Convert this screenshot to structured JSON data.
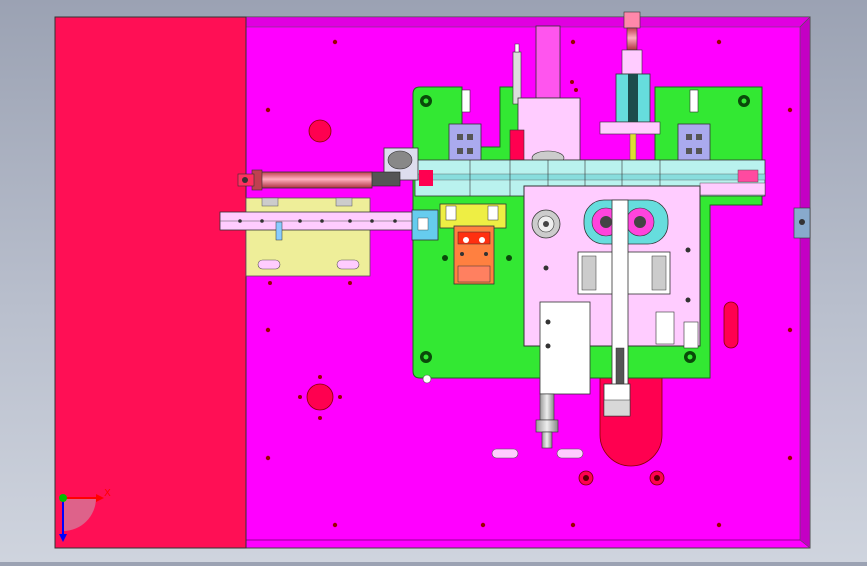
{
  "viewport": {
    "background_top": "#9ba2b3",
    "background_bottom": "#cfd4de"
  },
  "colors": {
    "plate": "#ff00ff",
    "side_block": "#ff0f55",
    "green_base": "#33e833",
    "cyan_track": "#b9f2ee",
    "light_pink": "#ffccff",
    "yellow_plate": "#eeee99",
    "orange_block": "#ff8040",
    "red_hole": "#ff0050",
    "blue_part": "#aaaaee",
    "steel": "#c8c8c8"
  },
  "triad": {
    "x_label": "X",
    "y_label": "Y",
    "x_color": "#ff0000",
    "y_color": "#00c000",
    "z_color": "#0000ff"
  },
  "icons": {
    "triad": "coordinate-triad-icon"
  }
}
